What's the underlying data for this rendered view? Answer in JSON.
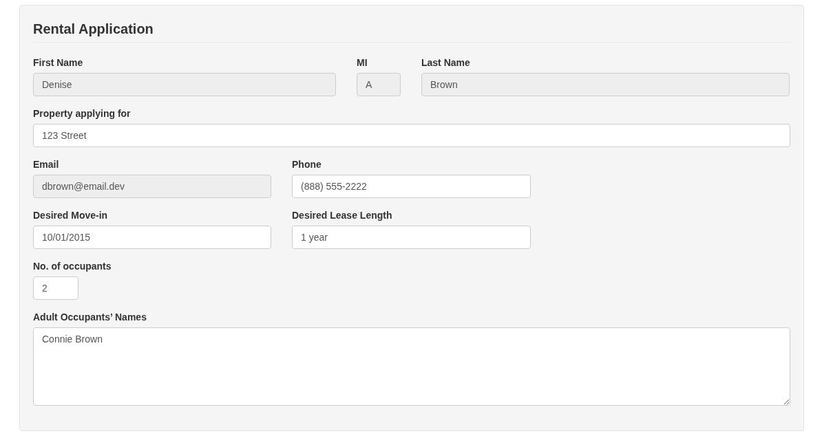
{
  "form": {
    "title": "Rental Application",
    "rows": [
      [
        {
          "label": "First Name",
          "value": "Denise",
          "disabled": true
        },
        {
          "label": "MI",
          "value": "A",
          "disabled": true
        },
        {
          "label": "Last Name",
          "value": "Brown",
          "disabled": true
        }
      ],
      [
        {
          "label": "Property applying for",
          "value": "123 Street",
          "disabled": false
        }
      ],
      [
        {
          "label": "Email",
          "value": "dbrown@email.dev",
          "disabled": true
        },
        {
          "label": "Phone",
          "value": "(888) 555-2222",
          "disabled": false
        }
      ],
      [
        {
          "label": "Desired Move-in",
          "value": "10/01/2015",
          "disabled": false
        },
        {
          "label": "Desired Lease Length",
          "value": "1 year",
          "disabled": false
        }
      ],
      [
        {
          "label": "No. of occupants",
          "value": "2",
          "disabled": false
        }
      ],
      [
        {
          "label": "Adult Occupants’ Names",
          "value": "Connie Brown",
          "disabled": false,
          "kind": "textarea"
        }
      ]
    ]
  }
}
